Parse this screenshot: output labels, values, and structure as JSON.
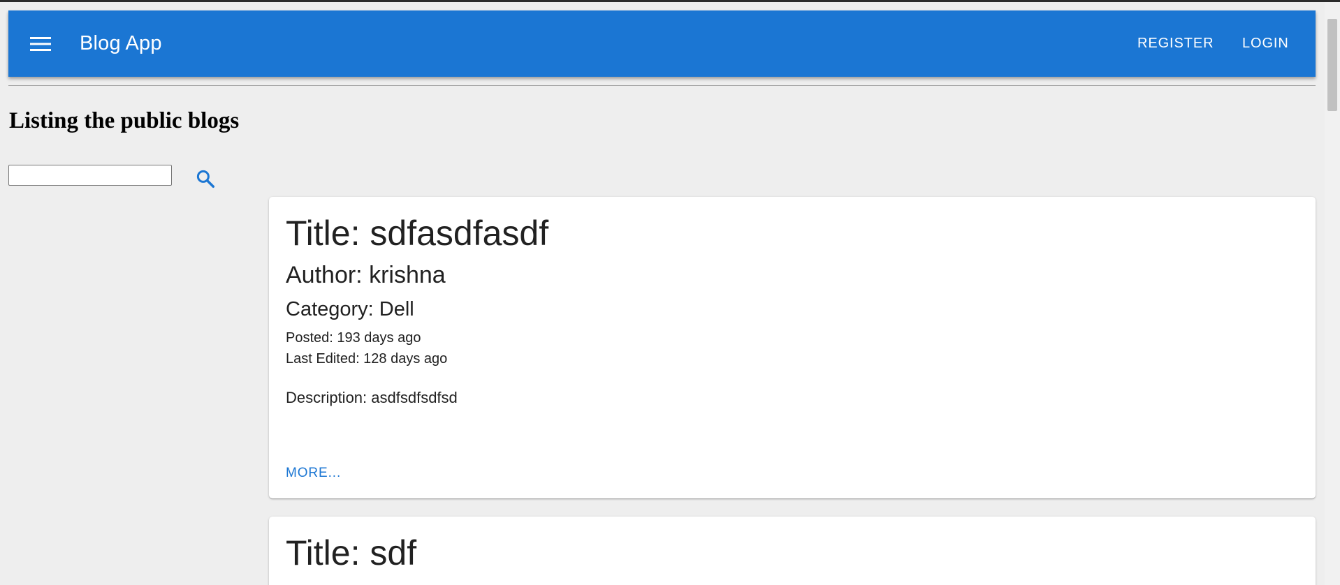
{
  "appbar": {
    "title": "Blog App",
    "menu_icon": "hamburger-menu-icon",
    "register_label": "REGISTER",
    "login_label": "LOGIN",
    "color": "#1b76d3"
  },
  "page": {
    "heading": "Listing the public blogs"
  },
  "search": {
    "value": "",
    "placeholder": "",
    "icon": "search-icon"
  },
  "blogs": [
    {
      "title": "Title: sdfasdfasdf",
      "author": "Author: krishna",
      "category": "Category: Dell",
      "posted": "Posted: 193 days ago",
      "edited": "Last Edited: 128 days ago",
      "description": "Description: asdfsdfsdfsd",
      "more_label": "MORE..."
    },
    {
      "title": "Title: sdf"
    }
  ]
}
